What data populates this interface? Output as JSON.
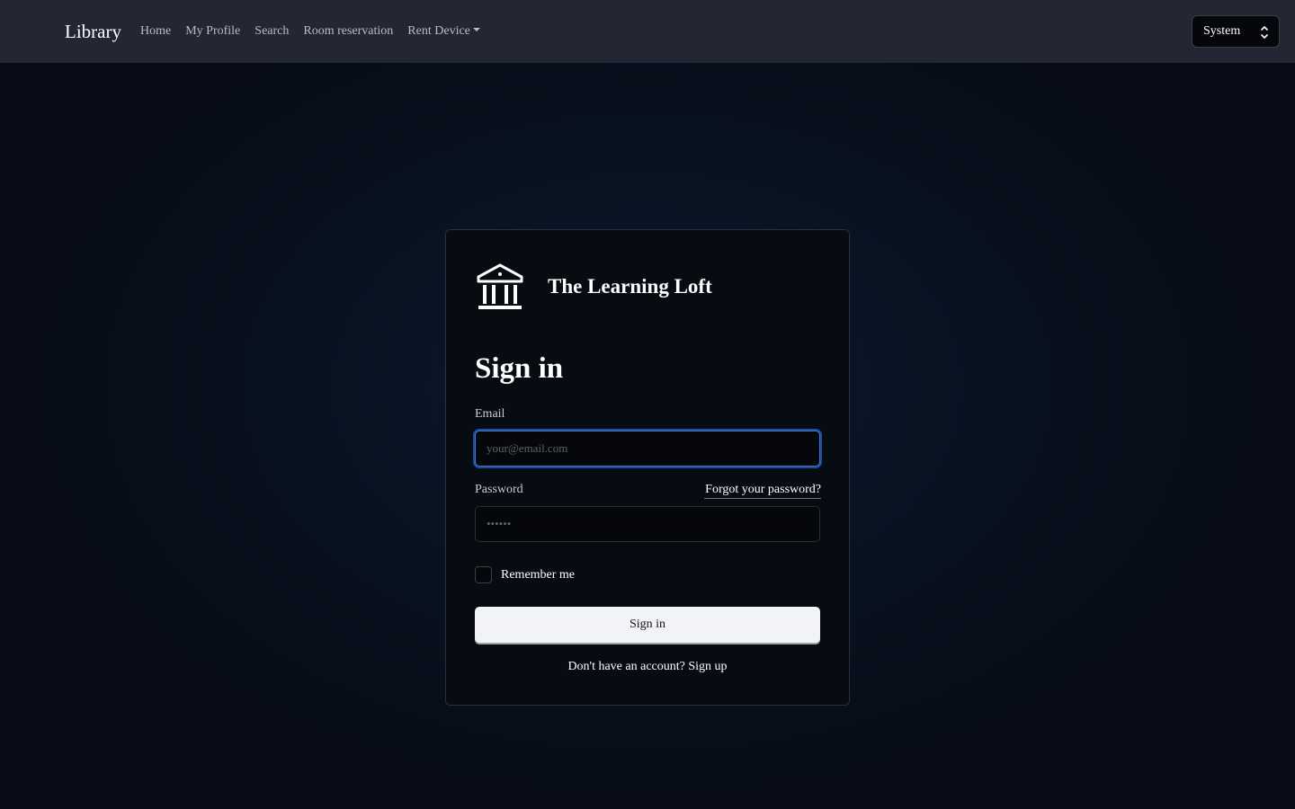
{
  "navbar": {
    "brand": "Library",
    "links": [
      "Home",
      "My Profile",
      "Search",
      "Room reservation"
    ],
    "dropdown_label": "Rent Device",
    "theme_select_value": "System"
  },
  "card": {
    "logo_icon": "bank-building-icon",
    "title": "The Learning Loft",
    "heading": "Sign in",
    "email": {
      "label": "Email",
      "placeholder": "your@email.com",
      "value": ""
    },
    "password": {
      "label": "Password",
      "placeholder": "••••••",
      "value": ""
    },
    "forgot_label": "Forgot your password?",
    "remember_label": "Remember me",
    "remember_checked": false,
    "submit_label": "Sign in",
    "signup_prompt": "Don't have an account?",
    "signup_link": "Sign up"
  },
  "colors": {
    "navbar_bg": "#222733",
    "card_bg": "#070b12",
    "focus_ring": "#3f78d8",
    "button_bg": "#f1f3f7"
  }
}
